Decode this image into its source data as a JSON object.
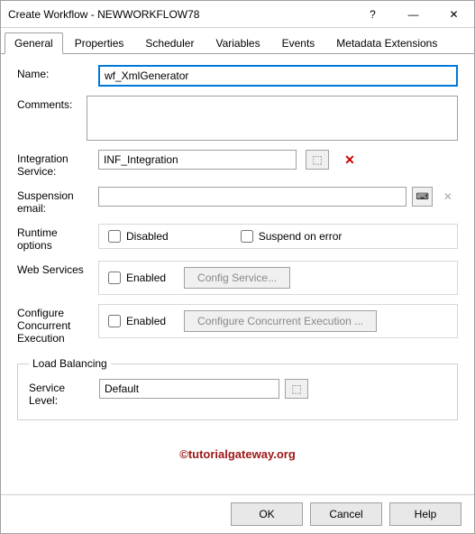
{
  "window": {
    "title": "Create Workflow - NEWWORKFLOW78"
  },
  "titlebar": {
    "help": "?",
    "min": "—",
    "close": "✕"
  },
  "tabs": {
    "items": [
      {
        "label": "General"
      },
      {
        "label": "Properties"
      },
      {
        "label": "Scheduler"
      },
      {
        "label": "Variables"
      },
      {
        "label": "Events"
      },
      {
        "label": "Metadata Extensions"
      }
    ]
  },
  "labels": {
    "name": "Name:",
    "comments": "Comments:",
    "integration": "Integration Service:",
    "suspension": "Suspension email:",
    "runtime": "Runtime options",
    "web": "Web Services",
    "concurrent": "Configure Concurrent Execution",
    "loadbal": "Load Balancing",
    "service_level": "Service Level:"
  },
  "values": {
    "name": "wf_XmlGenerator",
    "comments": "",
    "integration": "INF_Integration",
    "suspension": "",
    "disabled_label": "Disabled",
    "suspend_label": "Suspend on error",
    "enabled_label": "Enabled",
    "config_service_btn": "Config Service...",
    "config_concurrent_btn": "Configure Concurrent Execution ...",
    "service_level": "Default"
  },
  "watermark": "©tutorialgateway.org",
  "buttons": {
    "ok": "OK",
    "cancel": "Cancel",
    "help": "Help"
  }
}
